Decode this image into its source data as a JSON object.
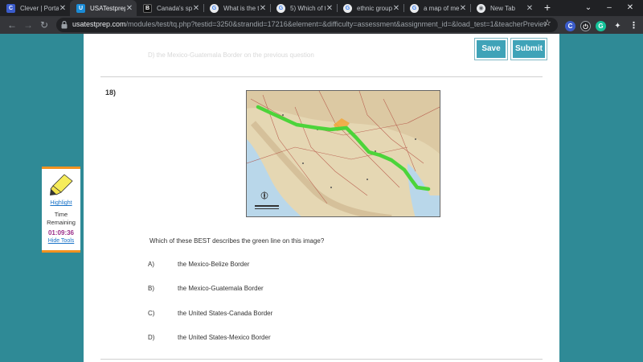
{
  "browser": {
    "tabs": [
      {
        "title": "Clever | Portal",
        "favicon": "clever-icon",
        "color": "#3b5ccb",
        "glyph": "C"
      },
      {
        "title": "USATestprep",
        "favicon": "usatestprep-icon",
        "color": "#1a8bd6",
        "glyph": "U",
        "active": true
      },
      {
        "title": "Canada's sp",
        "favicon": "brainly-icon",
        "color": "#111111",
        "glyph": "B"
      },
      {
        "title": "What is the t",
        "favicon": "google-icon",
        "color": "#e8eaed",
        "glyph": "G"
      },
      {
        "title": "5) Which of t",
        "favicon": "google-icon",
        "color": "#e8eaed",
        "glyph": "G"
      },
      {
        "title": "ethnic group",
        "favicon": "google-icon",
        "color": "#e8eaed",
        "glyph": "G"
      },
      {
        "title": "a map of me",
        "favicon": "google-icon",
        "color": "#e8eaed",
        "glyph": "G"
      },
      {
        "title": "New Tab",
        "favicon": "chrome-icon",
        "color": "#e8eaed",
        "glyph": "◉"
      }
    ],
    "new_tab": "+",
    "controls": {
      "minimize": "⌄",
      "maximize": "–"
    },
    "url_host": "usatestprep.com",
    "url_path": "/modules/test/tq.php?testid=3250&strandid=17216&element=&difficulty=assessment&assignment_id=&load_test=1&teacherPreview...",
    "extensions": [
      {
        "glyph": "C",
        "color": "#3b5ccb",
        "icon": "clever-extension-icon"
      },
      {
        "glyph": "⏻",
        "color": "#202124",
        "icon": "power-extension-icon"
      },
      {
        "glyph": "G",
        "color": "#15c39a",
        "icon": "grammarly-extension-icon"
      }
    ]
  },
  "header": {
    "save_label": "Save",
    "submit_label": "Submit",
    "faded_prev": "D)        the Mexico-Guatemala Border on the previous question"
  },
  "question": {
    "number": "18)",
    "text": "Which of these BEST describes the green line on this image?",
    "choices": [
      {
        "letter": "A)",
        "text": "the Mexico-Belize Border"
      },
      {
        "letter": "B)",
        "text": "the Mexico-Guatemala Border"
      },
      {
        "letter": "C)",
        "text": "the United States-Canada Border"
      },
      {
        "letter": "D)",
        "text": "the United States-Mexico Border"
      }
    ]
  },
  "tools": {
    "highlight_label": "Highlight",
    "time_label": "Time Remaining",
    "time_value": "01:09:36",
    "hide_label": "Hide Tools"
  },
  "colors": {
    "background": "#2f8a96",
    "button": "#3fa3b8",
    "timer": "#9c2e8a",
    "border_line": "#4cd43a",
    "tools_accent": "#f29220"
  }
}
